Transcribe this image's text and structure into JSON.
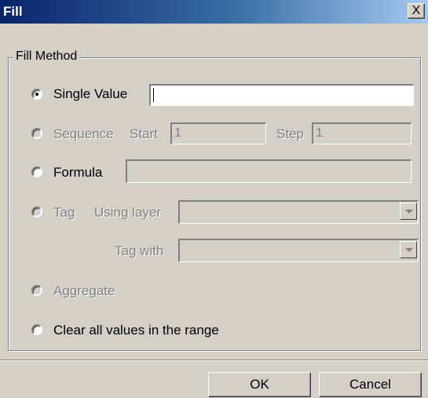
{
  "window": {
    "title": "Fill",
    "close_label": "X"
  },
  "group": {
    "legend": "Fill Method"
  },
  "options": {
    "single_value": {
      "label": "Single Value",
      "value": ""
    },
    "sequence": {
      "label": "Sequence",
      "start_label": "Start",
      "start_value": "1",
      "step_label": "Step",
      "step_value": "1"
    },
    "formula": {
      "label": "Formula",
      "value": ""
    },
    "tag": {
      "label": "Tag",
      "using_layer_label": "Using layer",
      "using_layer_value": "",
      "tag_with_label": "Tag with",
      "tag_with_value": ""
    },
    "aggregate": {
      "label": "Aggregate"
    },
    "clear": {
      "label": "Clear all values in the range"
    }
  },
  "buttons": {
    "ok": "OK",
    "cancel": "Cancel"
  },
  "state": {
    "selected": "single_value"
  }
}
